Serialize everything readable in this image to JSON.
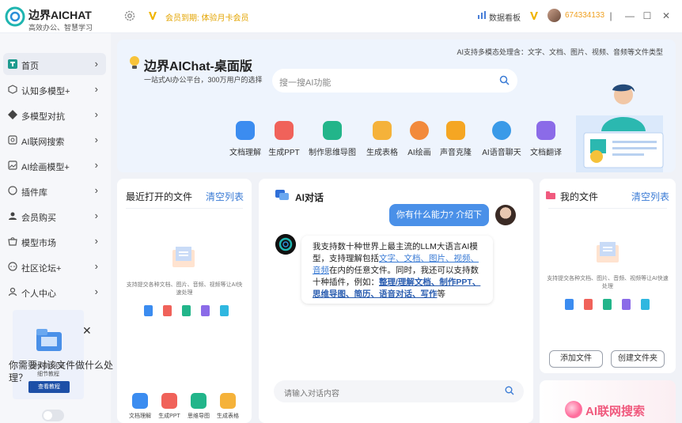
{
  "app": {
    "brand_title": "边界AICHAT",
    "brand_sub": "高效办公、智慧学习",
    "member_text": "会员到期: 体验月卡会员",
    "board_label": "数据看板",
    "user_id": "674334133"
  },
  "sidebar": {
    "items": [
      {
        "label": "首页",
        "icon": "home-icon"
      },
      {
        "label": "认知多模型+",
        "icon": "cube-icon"
      },
      {
        "label": "多模型对抗",
        "icon": "grid-icon"
      },
      {
        "label": "AI联网搜索",
        "icon": "search-doc-icon"
      },
      {
        "label": "AI绘画模型+",
        "icon": "image-icon"
      },
      {
        "label": "插件库",
        "icon": "plugin-icon"
      },
      {
        "label": "会员购买",
        "icon": "user-icon"
      },
      {
        "label": "模型市场",
        "icon": "store-icon"
      },
      {
        "label": "社区论坛+",
        "icon": "chat-icon"
      },
      {
        "label": "个人中心",
        "icon": "person-icon"
      }
    ],
    "promo": {
      "line1": "软件操作手册",
      "line2": "细节教程",
      "button": "查看教程"
    }
  },
  "hero": {
    "title": "边界AIChat-桌面版",
    "subtitle": "一站式AI办公平台，300万用户的选择",
    "caption": "AI支持多模态处理含：文字、文档、图片、视频、音频等文件类型",
    "search_placeholder": "搜一搜AI功能",
    "tools": [
      {
        "label": "文档理解",
        "color": "#3b8cf0"
      },
      {
        "label": "生成PPT",
        "color": "#f0625a"
      },
      {
        "label": "制作思维导图",
        "color": "#22b58a"
      },
      {
        "label": "生成表格",
        "color": "#f5b23a"
      },
      {
        "label": "AI绘画",
        "color": "#f28a3c"
      },
      {
        "label": "声音克隆",
        "color": "#f5a623"
      },
      {
        "label": "AI语音聊天",
        "color": "#3a9ae8"
      },
      {
        "label": "文档翻译",
        "color": "#8b6be8"
      }
    ]
  },
  "recent": {
    "title": "最近打开的文件",
    "clear": "清空列表",
    "support": "支持提交各种文档、图片、音频、视频等让AI快速处理",
    "question": "你需要对该文件做什么处理？",
    "actions": [
      {
        "label": "文档理解",
        "color": "#3b8cf0"
      },
      {
        "label": "生成PPT",
        "color": "#f0625a"
      },
      {
        "label": "思维导图",
        "color": "#22b58a"
      },
      {
        "label": "生成表格",
        "color": "#f5b23a"
      }
    ]
  },
  "chat": {
    "title": "AI对话",
    "user_message": "你有什么能力? 介绍下",
    "bot": {
      "p1": "我支持数十种世界上最主流的LLM大语言AI模型，支持理解包括",
      "l1": "文字、文档、图片、视频、音频",
      "p2": "在内的任意文件。同时，我还可以支持数十种插件，例如：",
      "l2": "整理/理解文档、制作PPT、思维导图、简历、语音对话、写作",
      "p3": "等"
    },
    "input_placeholder": "请输入对话内容"
  },
  "files": {
    "title": "我的文件",
    "clear": "清空列表",
    "support": "支持提交各种文档、图片、音频、视频等让AI快速处理",
    "add_button": "添加文件",
    "create_button": "创建文件夹"
  },
  "banner": {
    "text": "AI联网搜索"
  }
}
